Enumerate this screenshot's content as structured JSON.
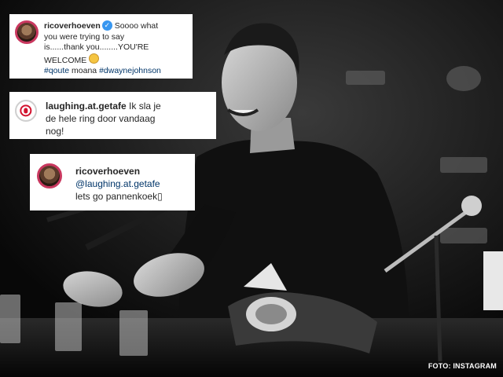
{
  "photo": {
    "description_alt": ""
  },
  "comments": [
    {
      "username": "ricoverhoeven",
      "verified": true,
      "line1": "Soooo what",
      "line2": "you were trying to say",
      "line3": "is......thank you........YOU'RE",
      "line4": "WELCOME",
      "hashtag1": "#qoute",
      "plain_word": "moana",
      "hashtag2": "#dwaynejohnson"
    },
    {
      "username": "laughing.at.getafe",
      "line1": "Ik sla je",
      "line2": "de hele ring door vandaag",
      "line3": "nog!"
    },
    {
      "username": "ricoverhoeven",
      "mention": "@laughing.at.getafe",
      "line2": "lets go pannenkoek▯"
    }
  ],
  "credit": "FOTO: INSTAGRAM",
  "colors": {
    "mention": "#003569",
    "verified": "#3897f0",
    "story_ring": "#c9385f"
  }
}
